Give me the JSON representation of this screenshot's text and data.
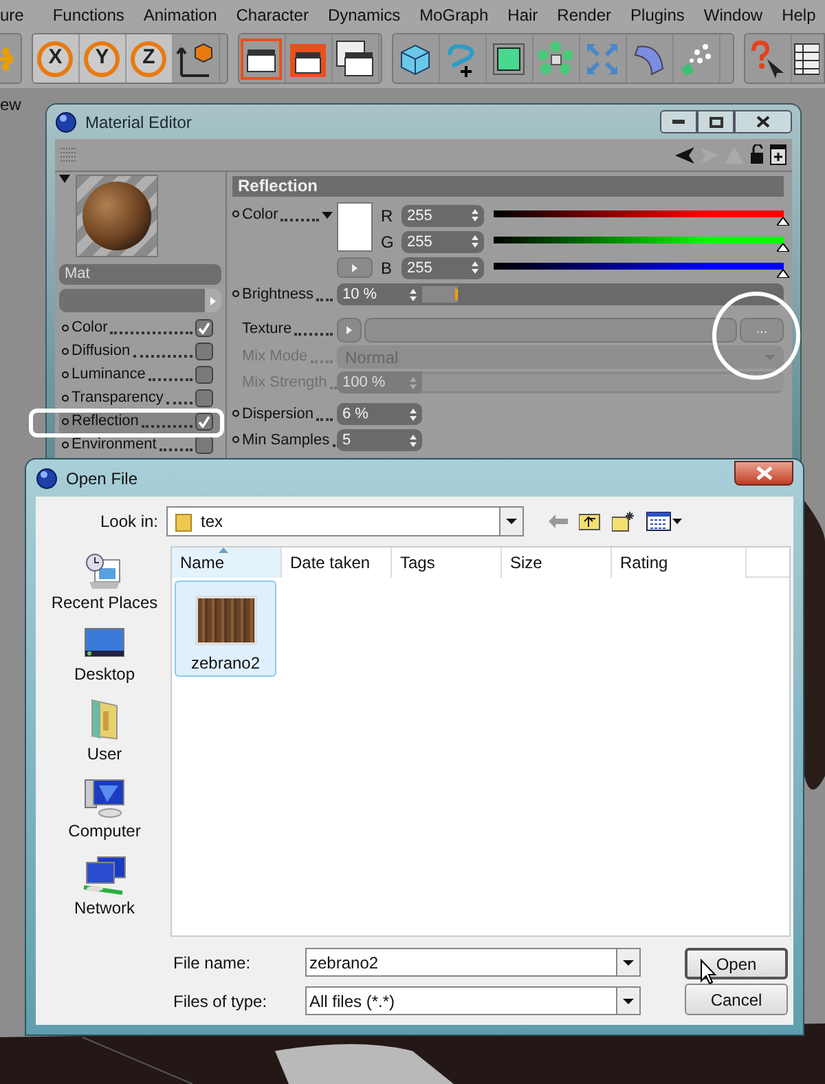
{
  "menu_bar": [
    "ure",
    "Functions",
    "Animation",
    "Character",
    "Dynamics",
    "MoGraph",
    "Hair",
    "Render",
    "Plugins",
    "Window",
    "Help"
  ],
  "toolbar": {
    "axis_buttons": [
      "X",
      "Y",
      "Z"
    ]
  },
  "viewport_menu": "ew",
  "material_editor": {
    "title": "Material Editor",
    "material_name": "Mat",
    "channels": [
      {
        "label": "Color",
        "checked": true,
        "selected": false
      },
      {
        "label": "Diffusion",
        "checked": false,
        "selected": false
      },
      {
        "label": "Luminance",
        "checked": false,
        "selected": false
      },
      {
        "label": "Transparency",
        "checked": false,
        "selected": false
      },
      {
        "label": "Reflection",
        "checked": true,
        "selected": true
      },
      {
        "label": "Environment",
        "checked": false,
        "selected": false
      }
    ],
    "section_title": "Reflection",
    "fields": [
      {
        "kind": "color",
        "label": "Color",
        "dot": true,
        "components": [
          {
            "name": "R",
            "value": "255",
            "level": 1,
            "color": "#ff0000"
          },
          {
            "name": "G",
            "value": "255",
            "level": 1,
            "color": "#00ff00"
          },
          {
            "name": "B",
            "value": "255",
            "level": 1,
            "color": "#0000ff"
          }
        ]
      },
      {
        "kind": "slider",
        "label": "Brightness",
        "dot": true,
        "value": "10 %",
        "level": 0.1,
        "disabled": false
      },
      {
        "kind": "texture",
        "label": "Texture",
        "dot": false,
        "button": "..."
      },
      {
        "kind": "dropdown",
        "label": "Mix Mode",
        "dot": false,
        "value": "Normal",
        "disabled": true
      },
      {
        "kind": "slider",
        "label": "Mix Strength",
        "dot": false,
        "value": "100 %",
        "level": 1,
        "disabled": true
      },
      {
        "kind": "number",
        "label": "Dispersion",
        "dot": true,
        "value": "6 %",
        "disabled": false
      },
      {
        "kind": "number",
        "label": "Min Samples",
        "dot": true,
        "value": "5",
        "disabled": false
      }
    ]
  },
  "open_file": {
    "title": "Open File",
    "look_in": {
      "label": "Look in:",
      "value": "tex"
    },
    "places": [
      {
        "kind": "recent",
        "label": "Recent Places"
      },
      {
        "kind": "desktop",
        "label": "Desktop"
      },
      {
        "kind": "user",
        "label": "User"
      },
      {
        "kind": "computer",
        "label": "Computer"
      },
      {
        "kind": "network",
        "label": "Network"
      }
    ],
    "columns": [
      {
        "label": "Name",
        "sorted": true
      },
      {
        "label": "Date taken",
        "sorted": false
      },
      {
        "label": "Tags",
        "sorted": false
      },
      {
        "label": "Size",
        "sorted": false
      },
      {
        "label": "Rating",
        "sorted": false
      }
    ],
    "files": [
      {
        "name": "zebrano2",
        "selected": true
      }
    ],
    "file_name": {
      "label": "File name:",
      "value": "zebrano2"
    },
    "file_type": {
      "label": "Files of type:",
      "value": "All files (*.*)"
    },
    "buttons": [
      {
        "label": "Open",
        "default": true
      },
      {
        "label": "Cancel",
        "default": false
      }
    ]
  }
}
